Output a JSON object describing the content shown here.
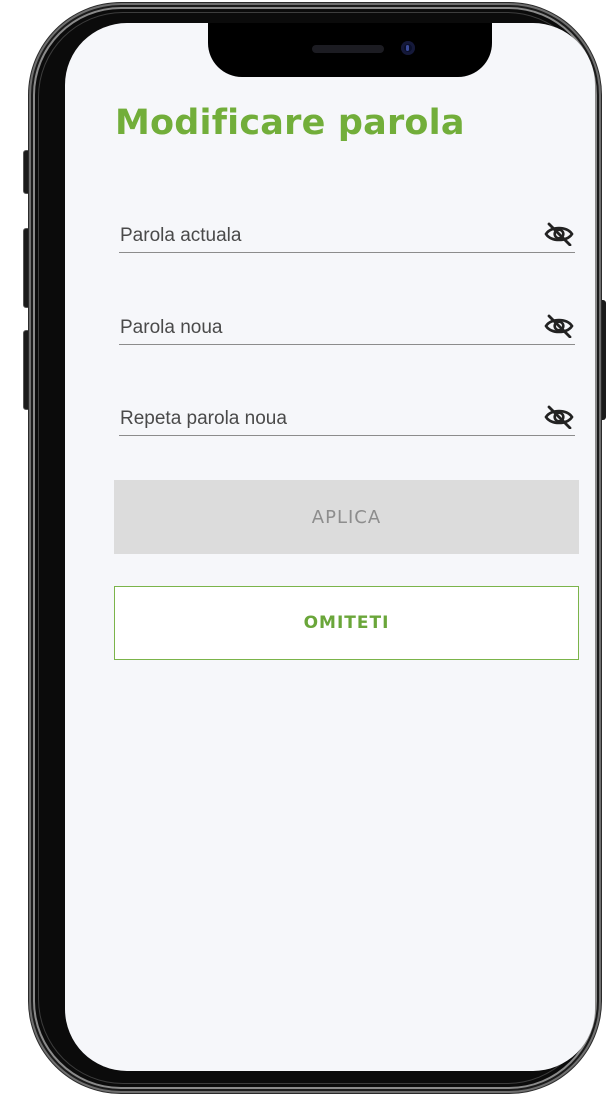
{
  "page": {
    "title": "Modificare parola"
  },
  "form": {
    "fields": [
      {
        "label": "Parola actuala",
        "icon": "eye-off-icon"
      },
      {
        "label": "Parola noua",
        "icon": "eye-off-icon"
      },
      {
        "label": "Repeta parola noua",
        "icon": "eye-off-icon"
      }
    ]
  },
  "actions": {
    "apply_label": "APLICA",
    "skip_label": "OMITETI"
  },
  "colors": {
    "accent_green": "#72ae3a",
    "disabled_button": "#dcdcdc",
    "screen_background": "#f6f7fa"
  }
}
